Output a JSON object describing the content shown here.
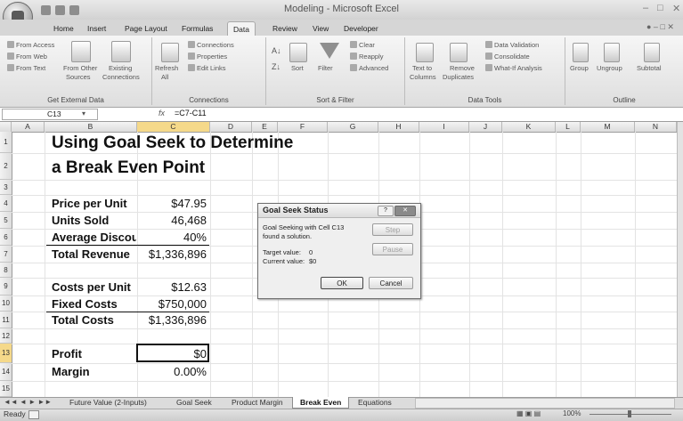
{
  "window": {
    "title": "Modeling - Microsoft Excel"
  },
  "ribbon_tabs": [
    "Home",
    "Insert",
    "Page Layout",
    "Formulas",
    "Data",
    "Review",
    "View",
    "Developer"
  ],
  "active_tab": "Data",
  "ribbon": {
    "get_external": {
      "label": "Get External Data",
      "from_access": "From Access",
      "from_web": "From Web",
      "from_text": "From Text",
      "from_other": "From Other",
      "from_other2": "Sources",
      "existing": "Existing",
      "existing2": "Connections"
    },
    "connections": {
      "label": "Connections",
      "refresh": "Refresh",
      "refresh2": "All",
      "connections": "Connections",
      "properties": "Properties",
      "edit_links": "Edit Links"
    },
    "sort_filter": {
      "label": "Sort & Filter",
      "sort": "Sort",
      "filter": "Filter",
      "clear": "Clear",
      "reapply": "Reapply",
      "advanced": "Advanced"
    },
    "data_tools": {
      "label": "Data Tools",
      "text_to": "Text to",
      "columns": "Columns",
      "remove": "Remove",
      "duplicates": "Duplicates",
      "validation": "Data Validation",
      "consolidate": "Consolidate",
      "whatif": "What-If Analysis"
    },
    "outline": {
      "label": "Outline",
      "group": "Group",
      "ungroup": "Ungroup",
      "subtotal": "Subtotal"
    }
  },
  "formula_bar": {
    "name_box": "C13",
    "fx": "fx",
    "formula": "=C7-C11"
  },
  "columns": [
    "A",
    "B",
    "C",
    "D",
    "E",
    "F",
    "G",
    "H",
    "I",
    "J",
    "K",
    "L",
    "M",
    "N"
  ],
  "rows": [
    "1",
    "2",
    "3",
    "4",
    "5",
    "6",
    "7",
    "8",
    "9",
    "10",
    "11",
    "12",
    "13",
    "14",
    "15"
  ],
  "sheet": {
    "title_line1": "Using Goal Seek to Determine",
    "title_line2": "a Break Even Point",
    "price_label": "Price per Unit",
    "price_value": "$47.95",
    "units_label": "Units Sold",
    "units_value": "46,468",
    "discount_label": "Average Discour",
    "discount_value": "40%",
    "revenue_label": "Total Revenue",
    "revenue_value": "$1,336,896",
    "cost_unit_label": "Costs per Unit",
    "cost_unit_value": "$12.63",
    "fixed_label": "Fixed Costs",
    "fixed_value": "$750,000",
    "total_costs_label": "Total Costs",
    "total_costs_value": "$1,336,896",
    "profit_label": "Profit",
    "profit_value": "$0",
    "margin_label": "Margin",
    "margin_value": "0.00%"
  },
  "dialog": {
    "title": "Goal Seek Status",
    "help": "?",
    "line1": "Goal Seeking with Cell C13",
    "line2": "found a solution.",
    "target_label": "Target value:",
    "target_value": "0",
    "current_label": "Current value:",
    "current_value": "$0",
    "step": "Step",
    "pause": "Pause",
    "ok": "OK",
    "cancel": "Cancel"
  },
  "sheet_tabs": [
    "Future Value (2-Inputs)",
    "Goal Seek",
    "Product Margin",
    "Break Even",
    "Equations"
  ],
  "active_sheet": "Break Even",
  "status": {
    "ready": "Ready",
    "zoom": "100%"
  }
}
